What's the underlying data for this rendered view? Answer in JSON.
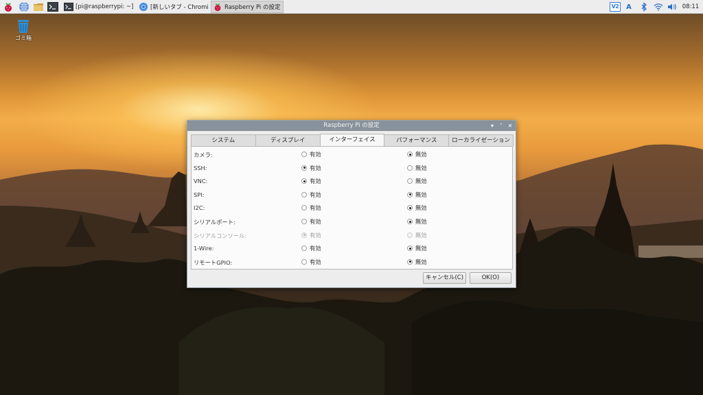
{
  "taskbar": {
    "tasks": [
      {
        "label": "[pi@raspberrypi: ~]"
      },
      {
        "label": "[新しいタブ - Chromi"
      },
      {
        "label": "Raspberry Pi の設定"
      }
    ],
    "tray": {
      "vnc_label": "V2",
      "keyboard_label": "A",
      "clock": "08:11"
    }
  },
  "desktop": {
    "trash_label": "ゴミ箱"
  },
  "dialog": {
    "title": "Raspberry Pi の設定",
    "tabs": [
      {
        "label": "システム"
      },
      {
        "label": "ディスプレイ"
      },
      {
        "label": "インターフェイス"
      },
      {
        "label": "パフォーマンス"
      },
      {
        "label": "ローカライゼーション"
      }
    ],
    "active_tab": 2,
    "enable_label": "有効",
    "disable_label": "無効",
    "rows": [
      {
        "label": "カメラ:",
        "enabled": false,
        "disabled": false
      },
      {
        "label": "SSH:",
        "enabled": true,
        "disabled": false
      },
      {
        "label": "VNC:",
        "enabled": true,
        "disabled": false
      },
      {
        "label": "SPI:",
        "enabled": false,
        "disabled": false
      },
      {
        "label": "I2C:",
        "enabled": false,
        "disabled": false
      },
      {
        "label": "シリアルポート:",
        "enabled": false,
        "disabled": false
      },
      {
        "label": "シリアルコンソール:",
        "enabled": true,
        "disabled": true
      },
      {
        "label": "1-Wire:",
        "enabled": false,
        "disabled": false
      },
      {
        "label": "リモートGPIO:",
        "enabled": false,
        "disabled": false
      }
    ],
    "cancel_label": "キャンセル(C)",
    "ok_label": "OK(O)"
  },
  "colors": {
    "titlebar": "#87929c",
    "taskbar": "#ededed",
    "dialog_bg": "#ededed"
  }
}
